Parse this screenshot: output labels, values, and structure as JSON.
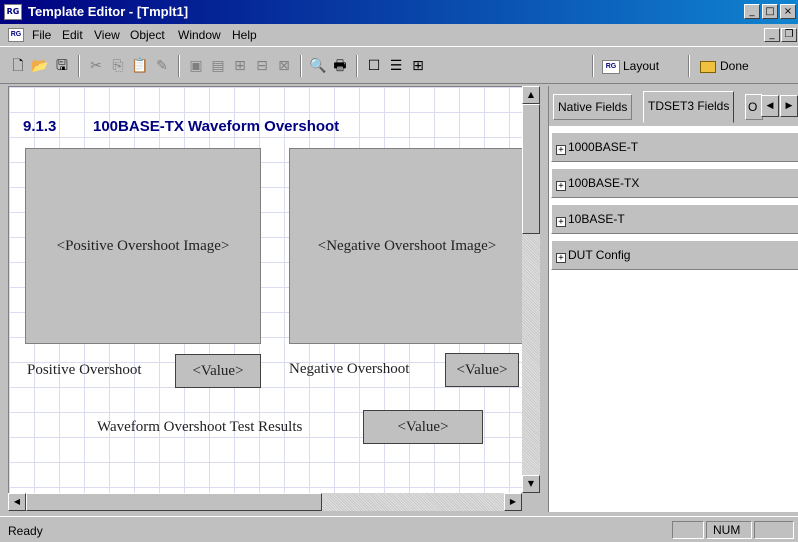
{
  "window": {
    "title": "Template Editor - [Tmplt1]",
    "app_icon_text": "RG",
    "minimize_glyph": "_",
    "maximize_glyph": "□",
    "close_glyph": "×"
  },
  "menubar": {
    "doc_icon_text": "RG",
    "items": [
      "File",
      "Edit",
      "View",
      "Object",
      "Window",
      "Help"
    ],
    "mdi_minimize_glyph": "_",
    "mdi_restore_glyph": "❐"
  },
  "toolbar": {
    "icons": {
      "new": "🗋",
      "open": "📂",
      "save": "🖫",
      "cut": "✂",
      "copy": "⎘",
      "paste": "📋",
      "erase": "✎",
      "bring_front": "▣",
      "send_back": "▤",
      "group": "⊞",
      "align": "⊟",
      "distribute": "⊠",
      "preview": "🔍",
      "print": "🖶",
      "layout_single": "☐",
      "layout_rows": "☰",
      "layout_grid": "⊞"
    },
    "layout_icon_text": "RG",
    "layout_label": "Layout",
    "done_label": "Done"
  },
  "canvas": {
    "section_number": "9.1.3",
    "section_title": "100BASE-TX Waveform Overshoot",
    "positive_image_placeholder": "<Positive Overshoot Image>",
    "negative_image_placeholder": "<Negative Overshoot Image>",
    "positive_label": "Positive Overshoot",
    "positive_value": "<Value>",
    "negative_label": "Negative Overshoot",
    "negative_value": "<Value>",
    "results_label": "Waveform Overshoot Test Results",
    "results_value": "<Value>"
  },
  "scrollbars": {
    "up_glyph": "▲",
    "down_glyph": "▼",
    "left_glyph": "◀",
    "right_glyph": "▶"
  },
  "right_panel": {
    "tabs": [
      {
        "label": "Native Fields",
        "active": false
      },
      {
        "label": "TDSET3 Fields",
        "active": true
      },
      {
        "label": "O",
        "active": false
      }
    ],
    "tab_prev_glyph": "◀",
    "tab_next_glyph": "▶",
    "expander_glyph": "+",
    "field_groups": [
      "1000BASE-T",
      "100BASE-TX",
      "10BASE-T",
      "DUT Config"
    ]
  },
  "statusbar": {
    "status": "Ready",
    "num_indicator": "NUM"
  }
}
